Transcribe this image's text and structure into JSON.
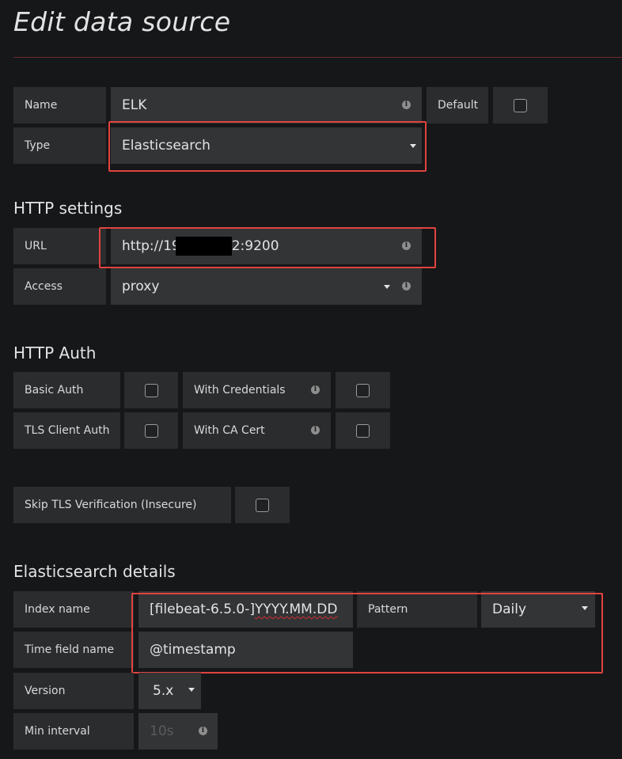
{
  "page": {
    "title": "Edit data source"
  },
  "basic": {
    "name_label": "Name",
    "name_value": "ELK",
    "default_label": "Default",
    "type_label": "Type",
    "type_value": "Elasticsearch"
  },
  "http": {
    "section_title": "HTTP settings",
    "url_label": "URL",
    "url_prefix": "http://19",
    "url_suffix": "2:9200",
    "access_label": "Access",
    "access_value": "proxy"
  },
  "auth": {
    "section_title": "HTTP Auth",
    "basic_auth_label": "Basic Auth",
    "with_credentials_label": "With Credentials",
    "tls_client_auth_label": "TLS Client Auth",
    "with_ca_cert_label": "With CA Cert",
    "skip_tls_label": "Skip TLS Verification (Insecure)"
  },
  "es": {
    "section_title": "Elasticsearch details",
    "index_label": "Index name",
    "index_value_prefix": "[filebeat-6.5.0-]",
    "index_value_suffix": "YYYY.MM.DD",
    "pattern_label": "Pattern",
    "pattern_value": "Daily",
    "time_field_label": "Time field name",
    "time_field_value": "@timestamp",
    "version_label": "Version",
    "version_value": "5.x",
    "min_interval_label": "Min interval",
    "min_interval_placeholder": "10s"
  },
  "icons": {
    "info": "info-circle-icon",
    "caret": "caret-down-icon",
    "checkbox": "checkbox-icon"
  },
  "colors": {
    "background": "#161719",
    "label_bg": "#2b2c2e",
    "field_bg": "#333436",
    "highlight": "#e0443e"
  }
}
